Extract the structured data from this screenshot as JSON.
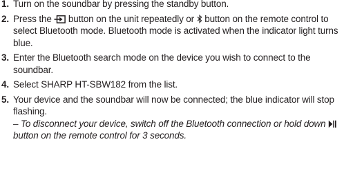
{
  "steps": [
    {
      "number": "1.",
      "text": "Turn on the soundbar by pressing the standby button."
    },
    {
      "number": "2.",
      "text_before_source_icon": "Press the",
      "source_icon": "source-input-icon",
      "text_between_icons": "button on the unit repeatedly or",
      "bluetooth_icon": "bluetooth-icon",
      "text_after_bluetooth_icon": "button on the remote control to select Bluetooth mode. Bluetooth mode is activated when the indicator light turns blue."
    },
    {
      "number": "3.",
      "text": "Enter the Bluetooth search mode on the device you wish to connect to the soundbar."
    },
    {
      "number": "4.",
      "text": "Select SHARP HT-SBW182 from the list."
    },
    {
      "number": "5.",
      "text": "Your device and the soundbar will now be connected; the blue indicator will stop flashing.",
      "note_before_icon": "– To disconnect your device, switch off the Bluetooth connection or hold down",
      "note_icon": "play-pause-icon",
      "note_after_icon": "button on the remote control for 3 seconds."
    }
  ],
  "colors": {
    "text": "#231f20",
    "background": "#ffffff"
  }
}
